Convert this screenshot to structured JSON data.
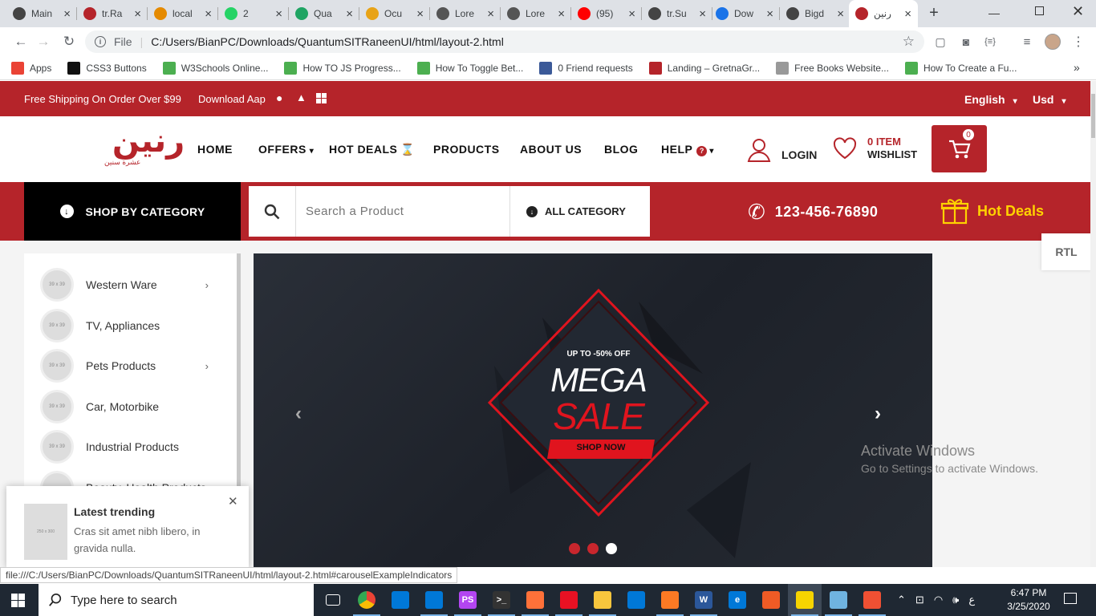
{
  "browser": {
    "tabs": [
      {
        "title": "Main",
        "icon": "github-icon",
        "color": "#444"
      },
      {
        "title": "tr.Ra",
        "icon": "raneen-icon",
        "color": "#b5242a"
      },
      {
        "title": "local",
        "icon": "pma-icon",
        "color": "#e58a00"
      },
      {
        "title": "2",
        "icon": "whatsapp-icon",
        "color": "#25d366"
      },
      {
        "title": "Qua",
        "icon": "drive-icon",
        "color": "#1fa463"
      },
      {
        "title": "Ocu",
        "icon": "chrome-ext-icon",
        "color": "#e8a317"
      },
      {
        "title": "Lore",
        "icon": "lorem-icon",
        "color": "#555"
      },
      {
        "title": "Lore",
        "icon": "lorem-icon",
        "color": "#555"
      },
      {
        "title": "(95)",
        "icon": "youtube-icon",
        "color": "#ff0000"
      },
      {
        "title": "tr.Su",
        "icon": "github-icon",
        "color": "#444"
      },
      {
        "title": "Dow",
        "icon": "download-icon",
        "color": "#1a73e8"
      },
      {
        "title": "Bigd",
        "icon": "github-icon",
        "color": "#444"
      },
      {
        "title": "رنين",
        "icon": "raneen-icon",
        "color": "#b5242a"
      }
    ],
    "address": {
      "scheme": "File",
      "url": "C:/Users/BianPC/Downloads/QuantumSITRaneenUI/html/layout-2.html"
    },
    "bookmarks": [
      {
        "label": "Apps",
        "icon": "apps-grid-icon",
        "color": "#ea4335"
      },
      {
        "label": "CSS3 Buttons",
        "icon": "codepen-icon",
        "color": "#111"
      },
      {
        "label": "W3Schools Online...",
        "icon": "w3schools-icon",
        "color": "#4caf50"
      },
      {
        "label": "How TO JS Progress...",
        "icon": "w3schools-icon",
        "color": "#4caf50"
      },
      {
        "label": "How To Toggle Bet...",
        "icon": "w3schools-icon",
        "color": "#4caf50"
      },
      {
        "label": "0 Friend requests",
        "icon": "facebook-icon",
        "color": "#3b5998"
      },
      {
        "label": "Landing – GretnaGr...",
        "icon": "landing-icon",
        "color": "#b5242a"
      },
      {
        "label": "Free Books Website...",
        "icon": "books-icon",
        "color": "#999"
      },
      {
        "label": "How To Create a Fu...",
        "icon": "w3schools-icon",
        "color": "#4caf50"
      }
    ]
  },
  "topbar": {
    "shipping": "Free Shipping On Order Over $99",
    "download": "Download Aap",
    "language": "English",
    "currency": "Usd"
  },
  "header": {
    "logo": "رنين",
    "logo_sub": "عشرة سنين",
    "nav": [
      "HOME",
      "OFFERS",
      "HOT DEALS",
      "PRODUCTS",
      "ABOUT US",
      "BLOG",
      "HELP"
    ],
    "login": "LOGIN",
    "wishlist_count": "0 ITEM",
    "wishlist": "WISHLIST",
    "cart_count": "0"
  },
  "redbar": {
    "shop_by": "SHOP BY CATEGORY",
    "search_placeholder": "Search a Product",
    "all_category": "ALL CATEGORY",
    "phone": "123-456-76890",
    "hot_deals": "Hot Deals"
  },
  "rtl": "RTL",
  "categories": [
    {
      "label": "Western Ware",
      "thumb": "39 x 39",
      "arrow": true
    },
    {
      "label": "TV, Appliances",
      "thumb": "39 x 39",
      "arrow": false
    },
    {
      "label": "Pets Products",
      "thumb": "39 x 39",
      "arrow": true
    },
    {
      "label": "Car, Motorbike",
      "thumb": "39 x 39",
      "arrow": false
    },
    {
      "label": "Industrial Products",
      "thumb": "39 x 39",
      "arrow": false
    },
    {
      "label": "Beauty, Health Products",
      "thumb": "",
      "arrow": false
    }
  ],
  "banner": {
    "upto": "UP TO -50% OFF",
    "mega": "MEGA",
    "sale": "SALE",
    "shop": "SHOP NOW",
    "active_slide": 3,
    "slides": 3
  },
  "toast": {
    "title": "Latest trending",
    "text": "Cras sit amet nibh libero, in gravida nulla.",
    "thumb": "250 x 300"
  },
  "watermark": {
    "title": "Activate Windows",
    "sub": "Go to Settings to activate Windows."
  },
  "status_url": "file:///C:/Users/BianPC/Downloads/QuantumSITRaneenUI/html/layout-2.html#carouselExampleIndicators",
  "taskbar": {
    "search": "Type here to search",
    "time": "6:47 PM",
    "date": "3/25/2020",
    "lang": "ع",
    "apps": [
      {
        "name": "task-view-icon",
        "color": "#1f2833",
        "label": ""
      },
      {
        "name": "chrome-icon",
        "color": "#4285f4",
        "label": ""
      },
      {
        "name": "mail-icon",
        "color": "#0078d7",
        "label": ""
      },
      {
        "name": "vscode-icon",
        "color": "#0078d7",
        "label": ""
      },
      {
        "name": "phpstorm-icon",
        "color": "#b345f1",
        "label": "PS"
      },
      {
        "name": "terminal-icon",
        "color": "#333",
        "label": ">_"
      },
      {
        "name": "firefox-icon",
        "color": "#ff7139",
        "label": ""
      },
      {
        "name": "snipping-icon",
        "color": "#e81123",
        "label": ""
      },
      {
        "name": "file-explorer-icon",
        "color": "#f8c63d",
        "label": ""
      },
      {
        "name": "store-icon",
        "color": "#0078d7",
        "label": ""
      },
      {
        "name": "xampp-icon",
        "color": "#fb7a24",
        "label": ""
      },
      {
        "name": "word-icon",
        "color": "#2b579a",
        "label": "W"
      },
      {
        "name": "edge-icon",
        "color": "#0078d7",
        "label": "e"
      },
      {
        "name": "postman-icon",
        "color": "#ef5b25",
        "label": ""
      },
      {
        "name": "sticky-notes-icon",
        "color": "#f7d400",
        "label": ""
      },
      {
        "name": "notepad-icon",
        "color": "#6fb3e0",
        "label": ""
      },
      {
        "name": "git-icon",
        "color": "#f05033",
        "label": ""
      }
    ]
  }
}
